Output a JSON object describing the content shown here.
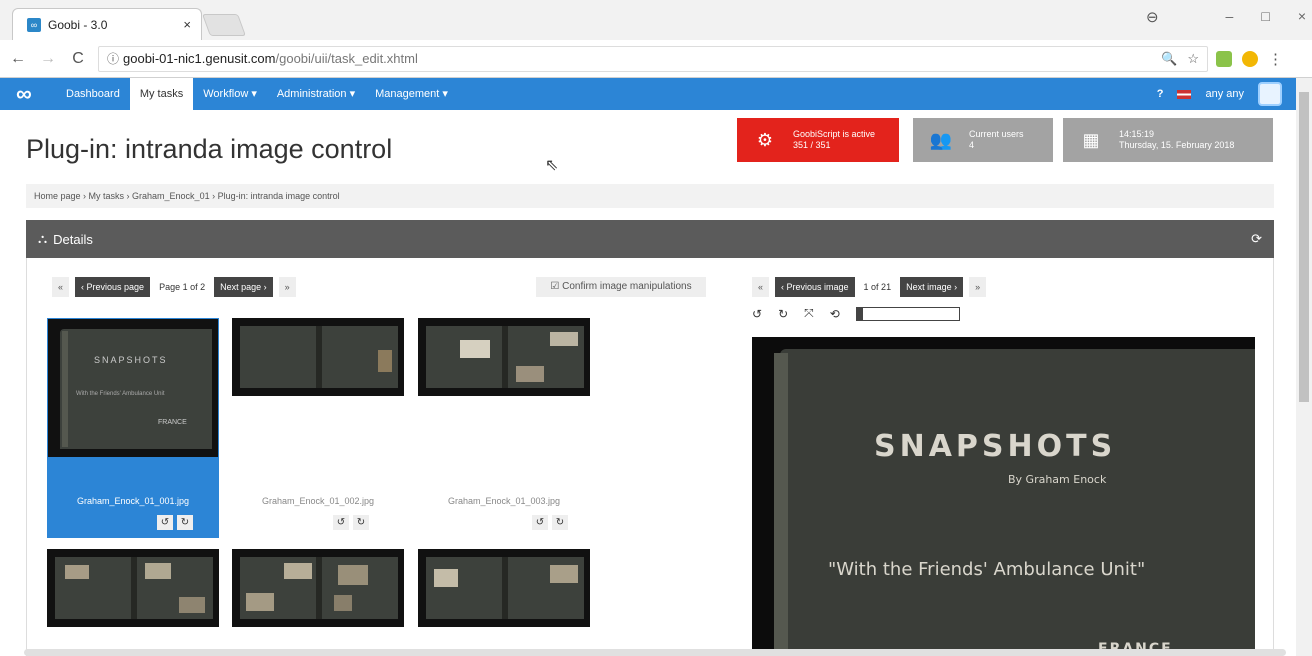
{
  "browser": {
    "tab_title": "Goobi - 3.0",
    "tab_favicon": "∞",
    "tab_close": "×",
    "profile_icon": "⊖",
    "win_min": "–",
    "win_max": "□",
    "win_close": "×",
    "back": "←",
    "forward": "→",
    "reload": "C",
    "info_icon": "ⓘ",
    "url_host": "goobi-01-nic1.genusit.com",
    "url_path": "/goobi/uii/task_edit.xhtml",
    "zoom_icon": "🔍",
    "star_icon": "☆",
    "menu_icon": "⋮"
  },
  "nav": {
    "logo": "∞",
    "items": [
      {
        "label": "Dashboard"
      },
      {
        "label": "My tasks"
      },
      {
        "label": "Workflow ▾"
      },
      {
        "label": "Administration ▾"
      },
      {
        "label": "Management ▾"
      }
    ],
    "help": "?",
    "user": "any any"
  },
  "page": {
    "title": "Plug-in: intranda image control",
    "breadcrumb": "Home page › My tasks › Graham_Enock_01 › Plug-in: intranda image control"
  },
  "widgets": {
    "script_line1": "GoobiScript is active",
    "script_line2": "351 / 351",
    "users_line1": "Current users",
    "users_line2": "4",
    "time_line1": "14:15:19",
    "time_line2": "Thursday, 15. February 2018"
  },
  "details": {
    "title": "Details",
    "left_pager": {
      "first": "«",
      "prev": "‹ Previous page",
      "label": "Page 1 of 2",
      "next": "Next page ›",
      "last": "»"
    },
    "confirm": "☑ Confirm image manipulations",
    "right_pager": {
      "first": "«",
      "prev": "‹ Previous image",
      "label": "1 of 21",
      "next": "Next image ›",
      "last": "»"
    },
    "thumbnails": [
      {
        "filename": "Graham_Enock_01_001.jpg"
      },
      {
        "filename": "Graham_Enock_01_002.jpg"
      },
      {
        "filename": "Graham_Enock_01_003.jpg"
      }
    ],
    "rotate_left": "↺",
    "rotate_right": "↻",
    "fullscreen": "⤧",
    "reset": "⟲",
    "cover_title": "SNAPSHOTS",
    "cover_by": "By Graham Enock",
    "cover_unit": "\"With the Friends' Ambulance Unit\"",
    "cover_country": "FRANCE"
  }
}
